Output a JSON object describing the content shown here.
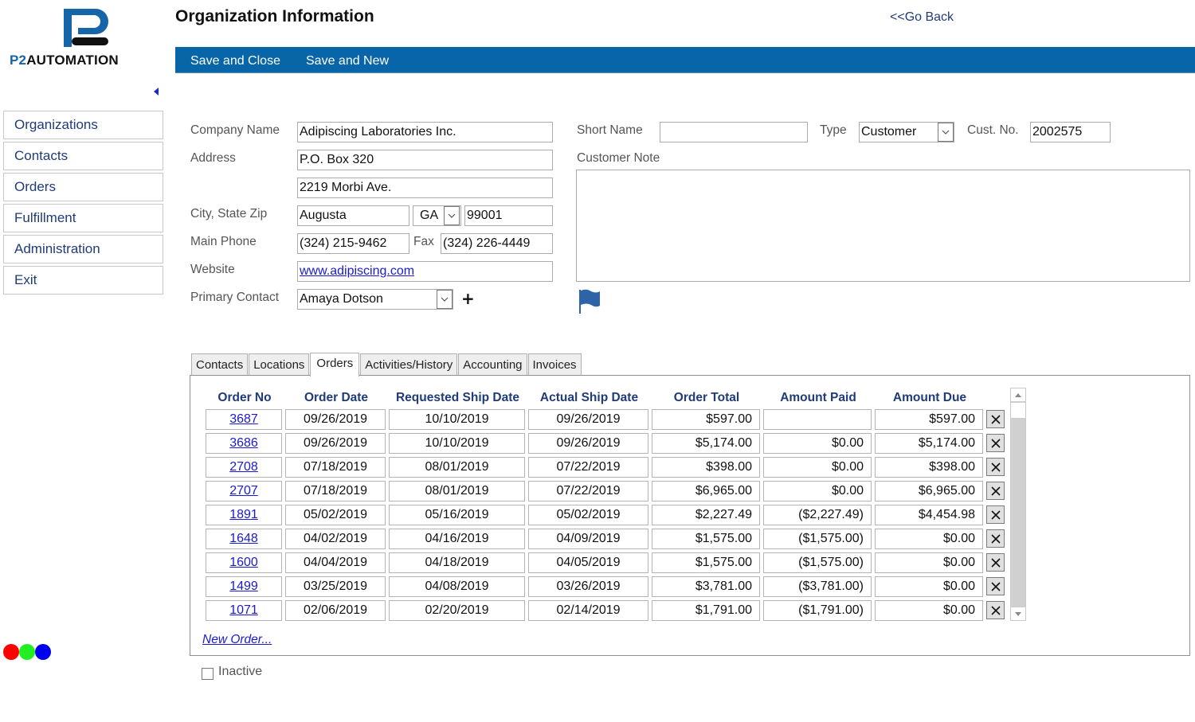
{
  "brand": {
    "name_prefix": "P2",
    "name_suffix": "AUTOMATION",
    "colors": {
      "primary": "#1565a8",
      "toolbar": "#0866a8",
      "link": "#1a1ad0",
      "nav_text": "#1f3b78"
    }
  },
  "header": {
    "title": "Organization Information",
    "go_back": "<<Go Back"
  },
  "toolbar": {
    "save_close": "Save and Close",
    "save_new": "Save and New"
  },
  "sidebar": {
    "items": [
      {
        "label": "Organizations"
      },
      {
        "label": "Contacts"
      },
      {
        "label": "Orders"
      },
      {
        "label": "Fulfillment"
      },
      {
        "label": "Administration"
      },
      {
        "label": "Exit"
      }
    ]
  },
  "status_dots": [
    "#ff0000",
    "#22ee22",
    "#0000ee"
  ],
  "form": {
    "company_name_label": "Company Name",
    "company_name": "Adipiscing Laboratories Inc.",
    "address_label": "Address",
    "address1": "P.O. Box 320",
    "address2": "2219 Morbi Ave.",
    "city_state_zip_label": "City, State Zip",
    "city": "Augusta",
    "state": "GA",
    "zip": "99001",
    "main_phone_label": "Main Phone",
    "main_phone": "(324) 215-9462",
    "fax_label": "Fax",
    "fax": "(324) 226-4449",
    "website_label": "Website",
    "website": "www.adipiscing.com",
    "primary_contact_label": "Primary Contact",
    "primary_contact": "Amaya Dotson",
    "add_contact": "+",
    "short_name_label": "Short Name",
    "short_name": "",
    "type_label": "Type",
    "type": "Customer",
    "cust_no_label": "Cust. No.",
    "cust_no": "2002575",
    "customer_note_label": "Customer Note",
    "customer_note": ""
  },
  "tabs": [
    {
      "label": "Contacts",
      "active": false
    },
    {
      "label": "Locations",
      "active": false
    },
    {
      "label": "Orders",
      "active": true
    },
    {
      "label": "Activities/History",
      "active": false
    },
    {
      "label": "Accounting",
      "active": false
    },
    {
      "label": "Invoices",
      "active": false
    }
  ],
  "orders": {
    "columns": [
      "Order No",
      "Order Date",
      "Requested Ship Date",
      "Actual Ship Date",
      "Order Total",
      "Amount Paid",
      "Amount Due"
    ],
    "rows": [
      {
        "order_no": "3687",
        "order_date": "09/26/2019",
        "req_ship": "10/10/2019",
        "actual_ship": "09/26/2019",
        "total": "$597.00",
        "paid": "",
        "due": "$597.00"
      },
      {
        "order_no": "3686",
        "order_date": "09/26/2019",
        "req_ship": "10/10/2019",
        "actual_ship": "09/26/2019",
        "total": "$5,174.00",
        "paid": "$0.00",
        "due": "$5,174.00"
      },
      {
        "order_no": "2708",
        "order_date": "07/18/2019",
        "req_ship": "08/01/2019",
        "actual_ship": "07/22/2019",
        "total": "$398.00",
        "paid": "$0.00",
        "due": "$398.00"
      },
      {
        "order_no": "2707",
        "order_date": "07/18/2019",
        "req_ship": "08/01/2019",
        "actual_ship": "07/22/2019",
        "total": "$6,965.00",
        "paid": "$0.00",
        "due": "$6,965.00"
      },
      {
        "order_no": "1891",
        "order_date": "05/02/2019",
        "req_ship": "05/16/2019",
        "actual_ship": "05/02/2019",
        "total": "$2,227.49",
        "paid": "($2,227.49)",
        "due": "$4,454.98"
      },
      {
        "order_no": "1648",
        "order_date": "04/02/2019",
        "req_ship": "04/16/2019",
        "actual_ship": "04/09/2019",
        "total": "$1,575.00",
        "paid": "($1,575.00)",
        "due": "$0.00"
      },
      {
        "order_no": "1600",
        "order_date": "04/04/2019",
        "req_ship": "04/18/2019",
        "actual_ship": "04/05/2019",
        "total": "$1,575.00",
        "paid": "($1,575.00)",
        "due": "$0.00"
      },
      {
        "order_no": "1499",
        "order_date": "03/25/2019",
        "req_ship": "04/08/2019",
        "actual_ship": "03/26/2019",
        "total": "$3,781.00",
        "paid": "($3,781.00)",
        "due": "$0.00"
      },
      {
        "order_no": "1071",
        "order_date": "02/06/2019",
        "req_ship": "02/20/2019",
        "actual_ship": "02/14/2019",
        "total": "$1,791.00",
        "paid": "($1,791.00)",
        "due": "$0.00"
      }
    ],
    "new_order_link": "New Order..."
  },
  "inactive": {
    "label": "Inactive",
    "checked": false
  }
}
